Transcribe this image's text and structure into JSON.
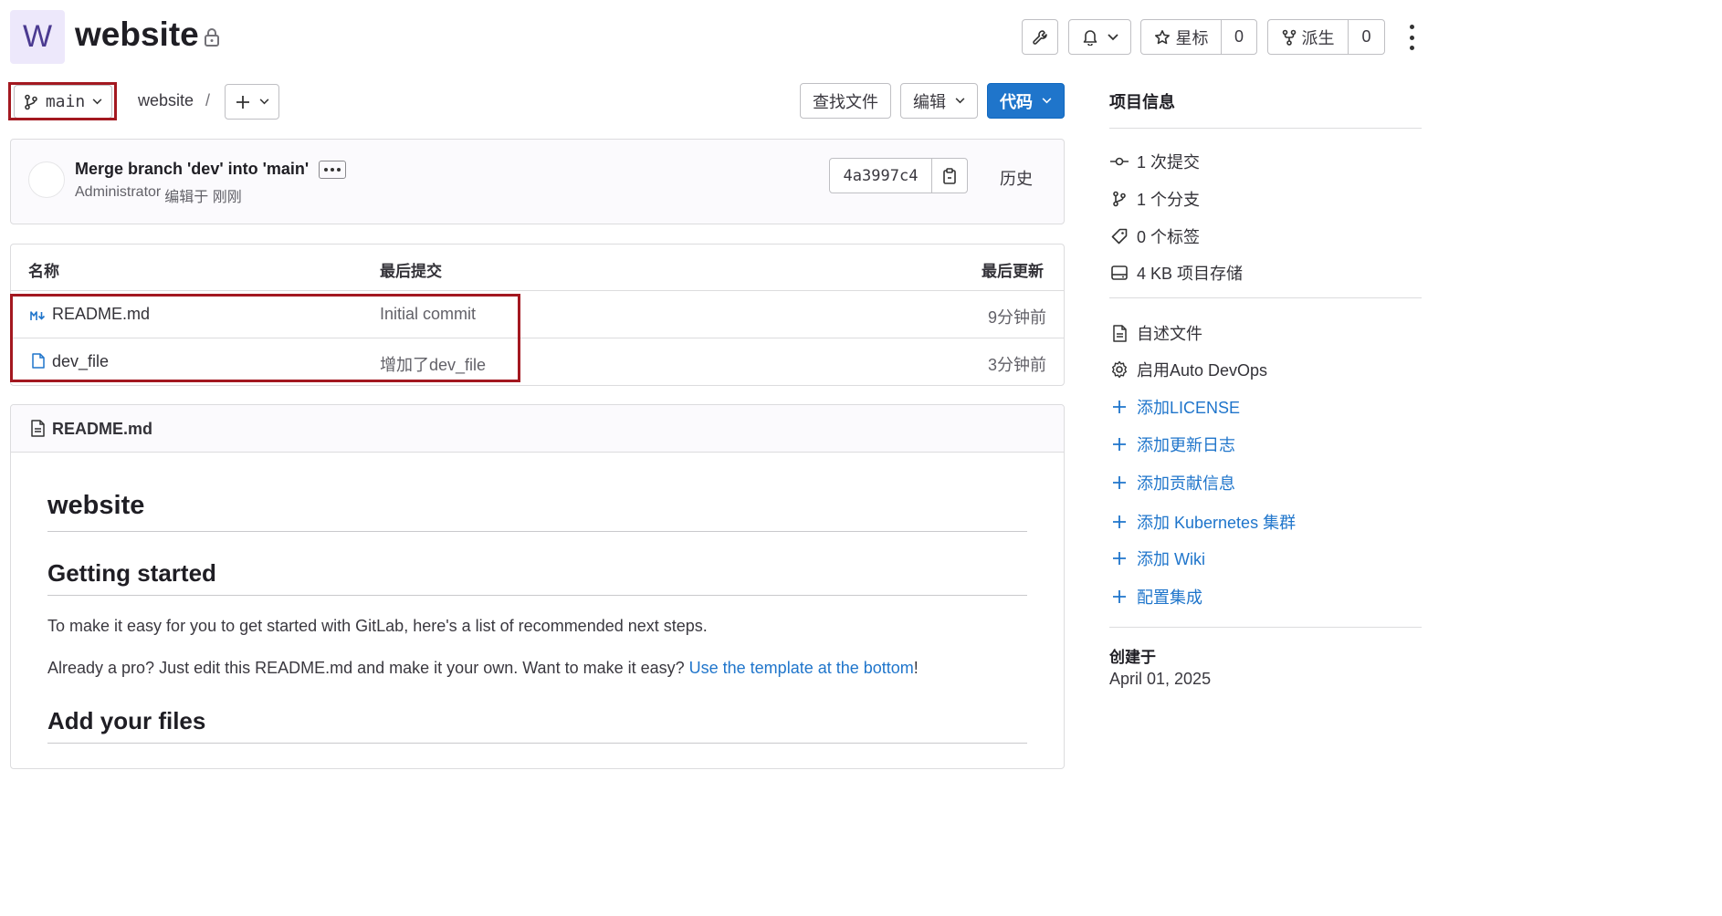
{
  "header": {
    "avatar_letter": "W",
    "project_name": "website",
    "star_label": "星标",
    "star_count": "0",
    "fork_label": "派生",
    "fork_count": "0"
  },
  "toolbar": {
    "branch": "main",
    "breadcrumb_project": "website",
    "breadcrumb_sep": "/",
    "find_file": "查找文件",
    "edit": "编辑",
    "code": "代码"
  },
  "commit": {
    "title": "Merge branch 'dev' into 'main'",
    "author": "Administrator",
    "meta": "编辑于 刚刚",
    "sha": "4a3997c4",
    "history": "历史"
  },
  "files_table": {
    "columns": [
      "名称",
      "最后提交",
      "最后更新"
    ],
    "rows": [
      {
        "name": "README.md",
        "icon": "markdown-icon",
        "last_commit": "Initial commit",
        "updated": "9分钟前"
      },
      {
        "name": "dev_file",
        "icon": "file-icon",
        "last_commit": "增加了dev_file",
        "updated": "3分钟前"
      }
    ]
  },
  "readme": {
    "file_title": "README.md",
    "h1": "website",
    "h2_getting_started": "Getting started",
    "p1": "To make it easy for you to get started with GitLab, here's a list of recommended next steps.",
    "p2_prefix": "Already a pro? Just edit this README.md and make it your own. Want to make it easy? ",
    "p2_link": "Use the template at the bottom",
    "p2_suffix": "!",
    "h2_add_files": "Add your files"
  },
  "sidebar": {
    "title": "项目信息",
    "stats": [
      {
        "icon": "commit-icon",
        "label": "1 次提交"
      },
      {
        "icon": "branch-icon",
        "label": "1 个分支"
      },
      {
        "icon": "tag-icon",
        "label": "0 个标签"
      },
      {
        "icon": "storage-icon",
        "label": "4 KB 项目存储"
      }
    ],
    "actions": [
      {
        "icon": "document-icon",
        "label": "自述文件"
      },
      {
        "icon": "settings-icon",
        "label": "启用Auto DevOps"
      },
      {
        "icon": "plus-icon",
        "label": "添加LICENSE"
      },
      {
        "icon": "plus-icon",
        "label": "添加更新日志"
      },
      {
        "icon": "plus-icon",
        "label": "添加贡献信息"
      },
      {
        "icon": "plus-icon",
        "label": "添加 Kubernetes 集群"
      },
      {
        "icon": "plus-icon",
        "label": "添加 Wiki"
      },
      {
        "icon": "plus-icon",
        "label": "配置集成"
      }
    ],
    "created_label": "创建于",
    "created_date": "April 01, 2025"
  },
  "colors": {
    "primary": "#1f75cb",
    "highlight_border": "#a31820",
    "avatar_bg": "#ede8fb"
  }
}
